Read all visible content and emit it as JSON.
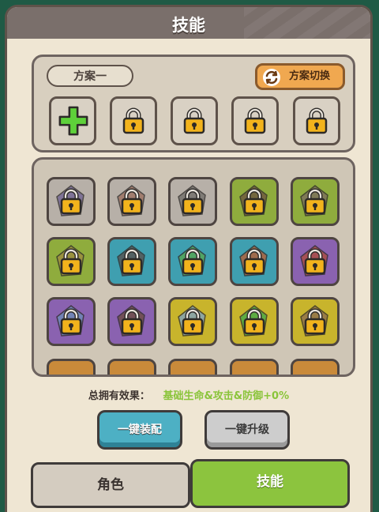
{
  "title": "技能",
  "preset": {
    "name": "方案一",
    "switch_label": "方案切换",
    "slots": [
      "add",
      "locked",
      "locked",
      "locked",
      "locked"
    ]
  },
  "skills": [
    {
      "bg": "#b7b0a8",
      "row": 0,
      "col": 0,
      "art": "#6c5f92"
    },
    {
      "bg": "#b7b0a8",
      "row": 0,
      "col": 1,
      "art": "#9a6d5b"
    },
    {
      "bg": "#b7b0a8",
      "row": 0,
      "col": 2,
      "art": "#6d6a66"
    },
    {
      "bg": "#8fac3d",
      "row": 0,
      "col": 3,
      "art": "#6b5140"
    },
    {
      "bg": "#8fac3d",
      "row": 0,
      "col": 4,
      "art": "#7a6a60"
    },
    {
      "bg": "#8fac3d",
      "row": 1,
      "col": 0,
      "art": "#a08a40"
    },
    {
      "bg": "#3f9fb0",
      "row": 1,
      "col": 1,
      "art": "#5a4d4a"
    },
    {
      "bg": "#3f9fb0",
      "row": 1,
      "col": 2,
      "art": "#58a64a"
    },
    {
      "bg": "#3f9fb0",
      "row": 1,
      "col": 3,
      "art": "#c05a2c"
    },
    {
      "bg": "#8a62b0",
      "row": 1,
      "col": 4,
      "art": "#b04a36"
    },
    {
      "bg": "#8a62b0",
      "row": 2,
      "col": 0,
      "art": "#6a8fb8"
    },
    {
      "bg": "#8a62b0",
      "row": 2,
      "col": 1,
      "art": "#6a4a3a"
    },
    {
      "bg": "#c8b42c",
      "row": 2,
      "col": 2,
      "art": "#7aa0c8"
    },
    {
      "bg": "#c8b42c",
      "row": 2,
      "col": 3,
      "art": "#3aa84a"
    },
    {
      "bg": "#c8b42c",
      "row": 2,
      "col": 4,
      "art": "#8a6a50"
    }
  ],
  "effect": {
    "label": "总拥有效果：",
    "value": "基础生命&攻击&防御+0%"
  },
  "buttons": {
    "equip": "一键装配",
    "upgrade": "一键升级"
  },
  "tabs": {
    "role": "角色",
    "skill": "技能",
    "active": "skill"
  },
  "colors": {
    "accent_green": "#8cc43e",
    "accent_blue": "#4db0c4",
    "accent_orange": "#f0a850"
  }
}
